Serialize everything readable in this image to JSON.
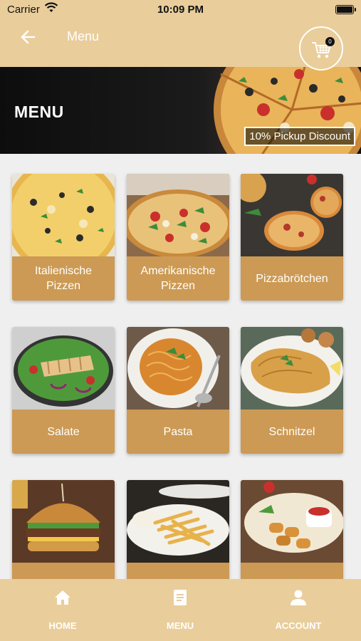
{
  "status": {
    "carrier": "Carrier",
    "time": "10:09 PM"
  },
  "header": {
    "title": "Menu",
    "cart_count": "0"
  },
  "banner": {
    "title": "MENU",
    "promo": "10% Pickup Discount"
  },
  "categories": [
    {
      "label": "Italienische Pizzen"
    },
    {
      "label": "Amerikanische Pizzen"
    },
    {
      "label": "Pizzabrötchen"
    },
    {
      "label": "Salate"
    },
    {
      "label": "Pasta"
    },
    {
      "label": "Schnitzel"
    },
    {
      "label": ""
    },
    {
      "label": ""
    },
    {
      "label": ""
    }
  ],
  "nav": [
    {
      "label": "HOME",
      "icon": "home-icon"
    },
    {
      "label": "MENU",
      "icon": "menu-icon"
    },
    {
      "label": "ACCOUNT",
      "icon": "account-icon"
    }
  ],
  "colors": {
    "header": "#e9cd9b",
    "card_label": "#cc9a54",
    "nav": "#e9cd9b"
  }
}
